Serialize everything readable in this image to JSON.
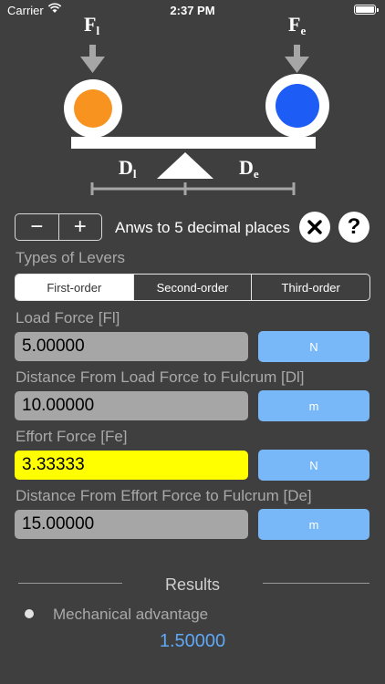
{
  "status_bar": {
    "carrier": "Carrier",
    "time": "2:37 PM"
  },
  "diagram": {
    "load_symbol": "F",
    "load_subscript": "l",
    "effort_symbol": "F",
    "effort_subscript": "e",
    "load_distance_symbol": "D",
    "load_distance_subscript": "l",
    "effort_distance_symbol": "D",
    "effort_distance_subscript": "e",
    "load_color": "#f7931e",
    "effort_color": "#1d5cf5"
  },
  "controls": {
    "minus_label": "−",
    "plus_label": "+",
    "decimal_text": "Anws to 5 decimal places",
    "close_icon": "close-icon",
    "help_label": "?"
  },
  "lever_types": {
    "label": "Types of Levers",
    "options": [
      "First-order",
      "Second-order",
      "Third-order"
    ],
    "selected": "First-order"
  },
  "inputs": {
    "load_force": {
      "label": "Load Force [Fl]",
      "value": "5.00000",
      "unit": "N"
    },
    "load_distance": {
      "label": "Distance From Load Force to Fulcrum [Dl]",
      "value": "10.00000",
      "unit": "m"
    },
    "effort_force": {
      "label": "Effort Force [Fe]",
      "value": "3.33333",
      "unit": "N",
      "highlight_color": "#ffff00"
    },
    "effort_distance": {
      "label": "Distance From Effort Force to Fulcrum [De]",
      "value": "15.00000",
      "unit": "m"
    }
  },
  "results": {
    "title": "Results",
    "mechanical_advantage_label": "Mechanical advantage",
    "mechanical_advantage_value": "1.50000"
  }
}
